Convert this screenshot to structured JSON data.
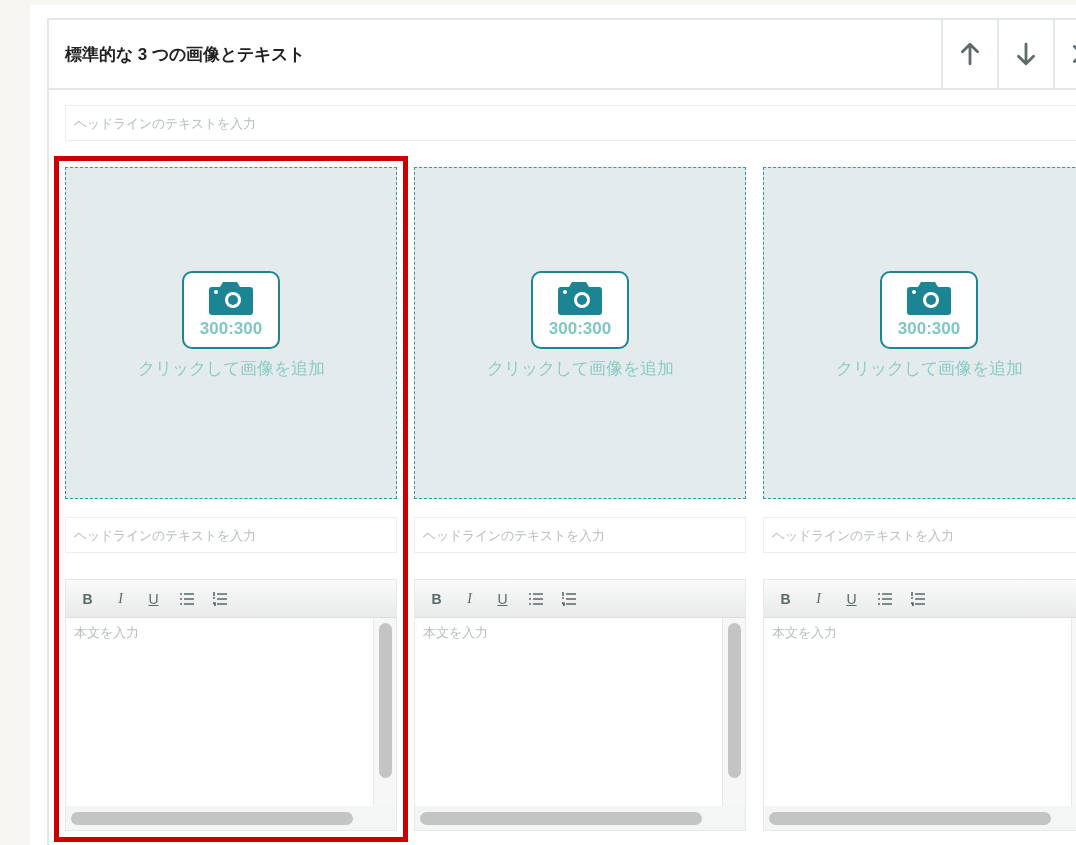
{
  "block": {
    "title": "標準的な 3 つの画像とテキスト",
    "actions": [
      {
        "kind": "up"
      },
      {
        "kind": "down"
      },
      {
        "kind": "close"
      }
    ],
    "headline": {
      "placeholder": "ヘッドラインのテキストを入力"
    },
    "columns": [
      {
        "selected": true,
        "image": {
          "ratio": "300:300",
          "label": "クリックして画像を追加"
        },
        "headline": {
          "placeholder": "ヘッドラインのテキストを入力"
        },
        "editor": {
          "tools": [
            {
              "kind": "bold",
              "label": "B"
            },
            {
              "kind": "italic",
              "label": "I"
            },
            {
              "kind": "underline",
              "label": "U"
            },
            {
              "kind": "bullets"
            },
            {
              "kind": "numbers"
            }
          ],
          "placeholder": "本文を入力"
        }
      },
      {
        "selected": false,
        "image": {
          "ratio": "300:300",
          "label": "クリックして画像を追加"
        },
        "headline": {
          "placeholder": "ヘッドラインのテキストを入力"
        },
        "editor": {
          "tools": [
            {
              "kind": "bold",
              "label": "B"
            },
            {
              "kind": "italic",
              "label": "I"
            },
            {
              "kind": "underline",
              "label": "U"
            },
            {
              "kind": "bullets"
            },
            {
              "kind": "numbers"
            }
          ],
          "placeholder": "本文を入力"
        }
      },
      {
        "selected": false,
        "image": {
          "ratio": "300:300",
          "label": "クリックして画像を追加"
        },
        "headline": {
          "placeholder": "ヘッドラインのテキストを入力"
        },
        "editor": {
          "tools": [
            {
              "kind": "bold",
              "label": "B"
            },
            {
              "kind": "italic",
              "label": "I"
            },
            {
              "kind": "underline",
              "label": "U"
            },
            {
              "kind": "bullets"
            },
            {
              "kind": "numbers"
            }
          ],
          "placeholder": "本文を入力"
        }
      }
    ]
  }
}
